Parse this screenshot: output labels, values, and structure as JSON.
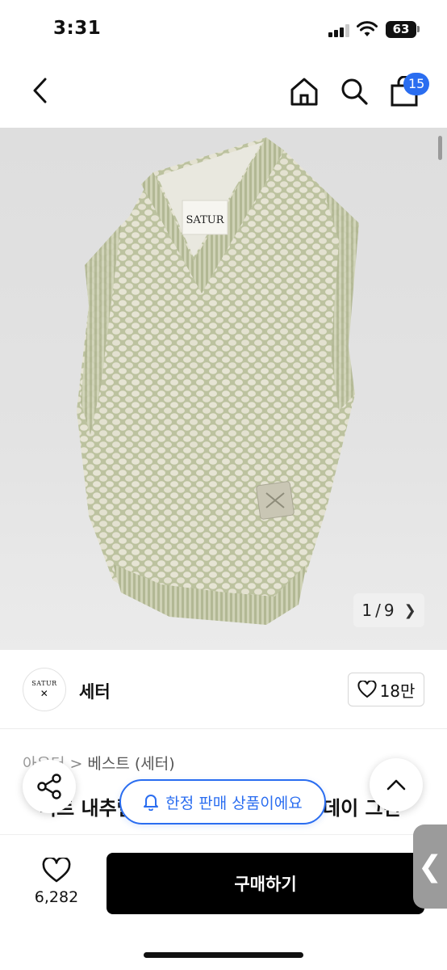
{
  "status_bar": {
    "time": "3:31",
    "battery": "63"
  },
  "header": {
    "back_icon": "chevron-left-icon",
    "home_icon": "home-icon",
    "search_icon": "search-icon",
    "bag_icon": "shopping-bag-icon",
    "cart_badge": "15"
  },
  "product_image": {
    "counter_current": "1",
    "counter_sep": "/",
    "counter_total": "9",
    "label_text": "SATUR"
  },
  "brand": {
    "logo_text": "SATUR",
    "name": "세터",
    "likes": "18만"
  },
  "category": {
    "first": "아우터",
    "second": "베스트 (세터)"
  },
  "title_partial": {
    "left": "니트 내추럴",
    "right": "데이 그린"
  },
  "limited_notice": "한정 판매 상품이에요",
  "bottom_bar": {
    "wish_count": "6,282",
    "buy_label": "구매하기"
  },
  "colors": {
    "accent": "#2a6df0",
    "buy_button": "#000000",
    "vest_green": "#b9bf9c"
  }
}
